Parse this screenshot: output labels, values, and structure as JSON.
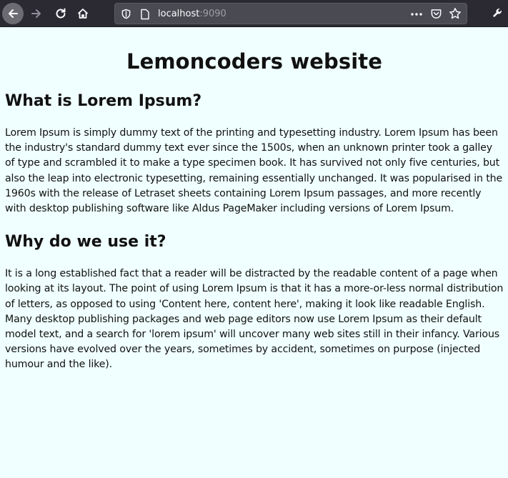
{
  "browser": {
    "url_host": "localhost",
    "url_port": ":9090"
  },
  "page": {
    "title": "Lemoncoders website",
    "sections": [
      {
        "heading": "What is Lorem Ipsum?",
        "body": "Lorem Ipsum is simply dummy text of the printing and typesetting industry. Lorem Ipsum has been the industry's standard dummy text ever since the 1500s, when an unknown printer took a galley of type and scrambled it to make a type specimen book. It has survived not only five centuries, but also the leap into electronic typesetting, remaining essentially unchanged. It was popularised in the 1960s with the release of Letraset sheets containing Lorem Ipsum passages, and more recently with desktop publishing software like Aldus PageMaker including versions of Lorem Ipsum."
      },
      {
        "heading": "Why do we use it?",
        "body": "It is a long established fact that a reader will be distracted by the readable content of a page when looking at its layout. The point of using Lorem Ipsum is that it has a more-or-less normal distribution of letters, as opposed to using 'Content here, content here', making it look like readable English. Many desktop publishing packages and web page editors now use Lorem Ipsum as their default model text, and a search for 'lorem ipsum' will uncover many web sites still in their infancy. Various versions have evolved over the years, sometimes by accident, sometimes on purpose (injected humour and the like)."
      }
    ]
  },
  "colors": {
    "page_background": "#f0ffff",
    "toolbar_background": "#2b2a33",
    "urlbar_background": "#4a4a52"
  },
  "icons": [
    "back-arrow-icon",
    "forward-arrow-icon",
    "reload-icon",
    "home-icon",
    "shield-icon",
    "page-icon",
    "more-dots-icon",
    "pocket-icon",
    "bookmark-star-icon",
    "wrench-icon"
  ]
}
